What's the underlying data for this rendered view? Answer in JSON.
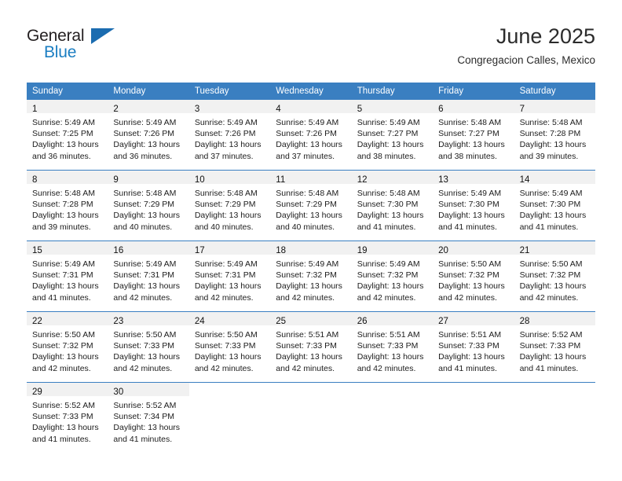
{
  "brand": {
    "name_part1": "General",
    "name_part2": "Blue",
    "logo_icon": "triangle-logo-icon"
  },
  "header": {
    "title": "June 2025",
    "subtitle": "Congregacion Calles, Mexico"
  },
  "calendar": {
    "weekday_headers": [
      "Sunday",
      "Monday",
      "Tuesday",
      "Wednesday",
      "Thursday",
      "Friday",
      "Saturday"
    ],
    "header_bg": "#3a7fc1",
    "daynum_bg": "#f1f1f1",
    "weeks": [
      [
        {
          "day": "1",
          "sunrise": "Sunrise: 5:49 AM",
          "sunset": "Sunset: 7:25 PM",
          "daylight_1": "Daylight: 13 hours",
          "daylight_2": "and 36 minutes."
        },
        {
          "day": "2",
          "sunrise": "Sunrise: 5:49 AM",
          "sunset": "Sunset: 7:26 PM",
          "daylight_1": "Daylight: 13 hours",
          "daylight_2": "and 36 minutes."
        },
        {
          "day": "3",
          "sunrise": "Sunrise: 5:49 AM",
          "sunset": "Sunset: 7:26 PM",
          "daylight_1": "Daylight: 13 hours",
          "daylight_2": "and 37 minutes."
        },
        {
          "day": "4",
          "sunrise": "Sunrise: 5:49 AM",
          "sunset": "Sunset: 7:26 PM",
          "daylight_1": "Daylight: 13 hours",
          "daylight_2": "and 37 minutes."
        },
        {
          "day": "5",
          "sunrise": "Sunrise: 5:49 AM",
          "sunset": "Sunset: 7:27 PM",
          "daylight_1": "Daylight: 13 hours",
          "daylight_2": "and 38 minutes."
        },
        {
          "day": "6",
          "sunrise": "Sunrise: 5:48 AM",
          "sunset": "Sunset: 7:27 PM",
          "daylight_1": "Daylight: 13 hours",
          "daylight_2": "and 38 minutes."
        },
        {
          "day": "7",
          "sunrise": "Sunrise: 5:48 AM",
          "sunset": "Sunset: 7:28 PM",
          "daylight_1": "Daylight: 13 hours",
          "daylight_2": "and 39 minutes."
        }
      ],
      [
        {
          "day": "8",
          "sunrise": "Sunrise: 5:48 AM",
          "sunset": "Sunset: 7:28 PM",
          "daylight_1": "Daylight: 13 hours",
          "daylight_2": "and 39 minutes."
        },
        {
          "day": "9",
          "sunrise": "Sunrise: 5:48 AM",
          "sunset": "Sunset: 7:29 PM",
          "daylight_1": "Daylight: 13 hours",
          "daylight_2": "and 40 minutes."
        },
        {
          "day": "10",
          "sunrise": "Sunrise: 5:48 AM",
          "sunset": "Sunset: 7:29 PM",
          "daylight_1": "Daylight: 13 hours",
          "daylight_2": "and 40 minutes."
        },
        {
          "day": "11",
          "sunrise": "Sunrise: 5:48 AM",
          "sunset": "Sunset: 7:29 PM",
          "daylight_1": "Daylight: 13 hours",
          "daylight_2": "and 40 minutes."
        },
        {
          "day": "12",
          "sunrise": "Sunrise: 5:48 AM",
          "sunset": "Sunset: 7:30 PM",
          "daylight_1": "Daylight: 13 hours",
          "daylight_2": "and 41 minutes."
        },
        {
          "day": "13",
          "sunrise": "Sunrise: 5:49 AM",
          "sunset": "Sunset: 7:30 PM",
          "daylight_1": "Daylight: 13 hours",
          "daylight_2": "and 41 minutes."
        },
        {
          "day": "14",
          "sunrise": "Sunrise: 5:49 AM",
          "sunset": "Sunset: 7:30 PM",
          "daylight_1": "Daylight: 13 hours",
          "daylight_2": "and 41 minutes."
        }
      ],
      [
        {
          "day": "15",
          "sunrise": "Sunrise: 5:49 AM",
          "sunset": "Sunset: 7:31 PM",
          "daylight_1": "Daylight: 13 hours",
          "daylight_2": "and 41 minutes."
        },
        {
          "day": "16",
          "sunrise": "Sunrise: 5:49 AM",
          "sunset": "Sunset: 7:31 PM",
          "daylight_1": "Daylight: 13 hours",
          "daylight_2": "and 42 minutes."
        },
        {
          "day": "17",
          "sunrise": "Sunrise: 5:49 AM",
          "sunset": "Sunset: 7:31 PM",
          "daylight_1": "Daylight: 13 hours",
          "daylight_2": "and 42 minutes."
        },
        {
          "day": "18",
          "sunrise": "Sunrise: 5:49 AM",
          "sunset": "Sunset: 7:32 PM",
          "daylight_1": "Daylight: 13 hours",
          "daylight_2": "and 42 minutes."
        },
        {
          "day": "19",
          "sunrise": "Sunrise: 5:49 AM",
          "sunset": "Sunset: 7:32 PM",
          "daylight_1": "Daylight: 13 hours",
          "daylight_2": "and 42 minutes."
        },
        {
          "day": "20",
          "sunrise": "Sunrise: 5:50 AM",
          "sunset": "Sunset: 7:32 PM",
          "daylight_1": "Daylight: 13 hours",
          "daylight_2": "and 42 minutes."
        },
        {
          "day": "21",
          "sunrise": "Sunrise: 5:50 AM",
          "sunset": "Sunset: 7:32 PM",
          "daylight_1": "Daylight: 13 hours",
          "daylight_2": "and 42 minutes."
        }
      ],
      [
        {
          "day": "22",
          "sunrise": "Sunrise: 5:50 AM",
          "sunset": "Sunset: 7:32 PM",
          "daylight_1": "Daylight: 13 hours",
          "daylight_2": "and 42 minutes."
        },
        {
          "day": "23",
          "sunrise": "Sunrise: 5:50 AM",
          "sunset": "Sunset: 7:33 PM",
          "daylight_1": "Daylight: 13 hours",
          "daylight_2": "and 42 minutes."
        },
        {
          "day": "24",
          "sunrise": "Sunrise: 5:50 AM",
          "sunset": "Sunset: 7:33 PM",
          "daylight_1": "Daylight: 13 hours",
          "daylight_2": "and 42 minutes."
        },
        {
          "day": "25",
          "sunrise": "Sunrise: 5:51 AM",
          "sunset": "Sunset: 7:33 PM",
          "daylight_1": "Daylight: 13 hours",
          "daylight_2": "and 42 minutes."
        },
        {
          "day": "26",
          "sunrise": "Sunrise: 5:51 AM",
          "sunset": "Sunset: 7:33 PM",
          "daylight_1": "Daylight: 13 hours",
          "daylight_2": "and 42 minutes."
        },
        {
          "day": "27",
          "sunrise": "Sunrise: 5:51 AM",
          "sunset": "Sunset: 7:33 PM",
          "daylight_1": "Daylight: 13 hours",
          "daylight_2": "and 41 minutes."
        },
        {
          "day": "28",
          "sunrise": "Sunrise: 5:52 AM",
          "sunset": "Sunset: 7:33 PM",
          "daylight_1": "Daylight: 13 hours",
          "daylight_2": "and 41 minutes."
        }
      ],
      [
        {
          "day": "29",
          "sunrise": "Sunrise: 5:52 AM",
          "sunset": "Sunset: 7:33 PM",
          "daylight_1": "Daylight: 13 hours",
          "daylight_2": "and 41 minutes."
        },
        {
          "day": "30",
          "sunrise": "Sunrise: 5:52 AM",
          "sunset": "Sunset: 7:34 PM",
          "daylight_1": "Daylight: 13 hours",
          "daylight_2": "and 41 minutes."
        },
        {
          "day": "",
          "sunrise": "",
          "sunset": "",
          "daylight_1": "",
          "daylight_2": ""
        },
        {
          "day": "",
          "sunrise": "",
          "sunset": "",
          "daylight_1": "",
          "daylight_2": ""
        },
        {
          "day": "",
          "sunrise": "",
          "sunset": "",
          "daylight_1": "",
          "daylight_2": ""
        },
        {
          "day": "",
          "sunrise": "",
          "sunset": "",
          "daylight_1": "",
          "daylight_2": ""
        },
        {
          "day": "",
          "sunrise": "",
          "sunset": "",
          "daylight_1": "",
          "daylight_2": ""
        }
      ]
    ]
  }
}
